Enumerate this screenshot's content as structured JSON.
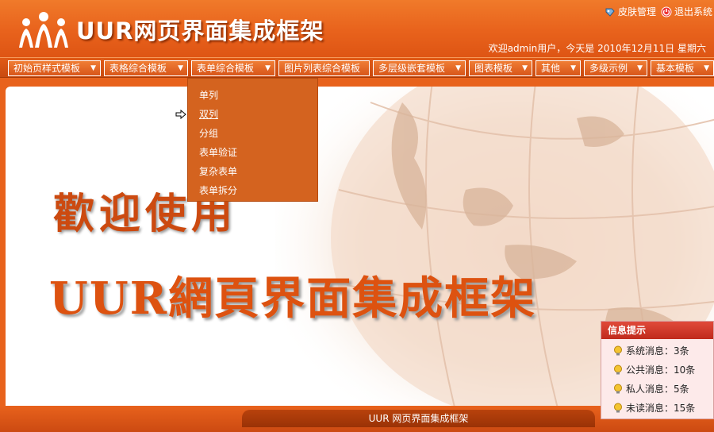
{
  "header": {
    "title": "UUR网页界面集成框架",
    "links": [
      {
        "label": "皮肤管理",
        "icon": "skin-icon"
      },
      {
        "label": "退出系统",
        "icon": "logout-icon"
      }
    ],
    "welcome": "欢迎admin用户，今天是 2010年12月11日 星期六"
  },
  "nav": {
    "items": [
      {
        "label": "初始页样式模板",
        "has_arrow": true
      },
      {
        "label": "表格综合模板",
        "has_arrow": true
      },
      {
        "label": "表单综合模板",
        "has_arrow": true
      },
      {
        "label": "图片列表综合模板",
        "has_arrow": false
      },
      {
        "label": "多层级嵌套模板",
        "has_arrow": true
      },
      {
        "label": "图表模板",
        "has_arrow": true
      },
      {
        "label": "其他",
        "has_arrow": true
      },
      {
        "label": "多级示例",
        "has_arrow": true
      },
      {
        "label": "基本模板",
        "has_arrow": true
      }
    ],
    "arrow_glyph": "▼"
  },
  "dropdown": {
    "items": [
      "单列",
      "双列",
      "分组",
      "表单验证",
      "复杂表单",
      "表单拆分"
    ],
    "active_index": 1
  },
  "main": {
    "welcome_line1": "歡迎使用",
    "welcome_line2": "UUR網頁界面集成框架"
  },
  "info_panel": {
    "title": "信息提示",
    "items": [
      {
        "label": "系统消息：3条",
        "icon": "lightbulb-icon"
      },
      {
        "label": "公共消息：10条",
        "icon": "lightbulb-icon"
      },
      {
        "label": "私人消息：5条",
        "icon": "lightbulb-icon"
      },
      {
        "label": "未读消息：15条",
        "icon": "lightbulb-icon"
      }
    ]
  },
  "footer": {
    "text": "UUR 网页界面集成框架"
  },
  "colors": {
    "brand_orange": "#e8621c",
    "dropdown_bg": "#d4631f",
    "info_title_red": "#c02a1c"
  }
}
